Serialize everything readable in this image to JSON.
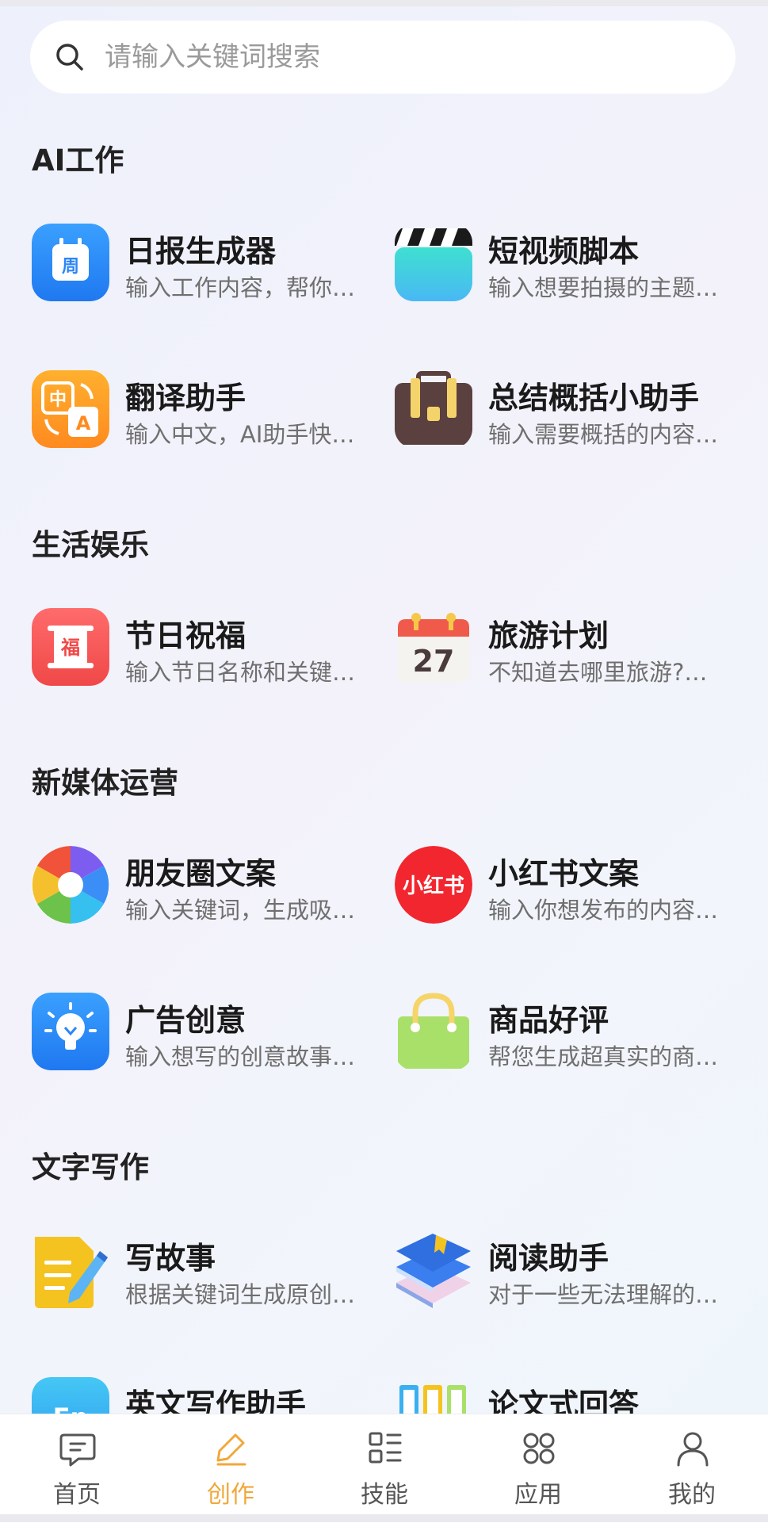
{
  "search": {
    "placeholder": "请输入关键词搜索"
  },
  "sections": [
    {
      "title": "AI工作",
      "tools": [
        {
          "name": "日报生成器",
          "desc": "输入工作内容，帮你…",
          "icon": "calendar-week-icon",
          "iconLabel": "周"
        },
        {
          "name": "短视频脚本",
          "desc": "输入想要拍摄的主题…",
          "icon": "clapperboard-icon"
        },
        {
          "name": "翻译助手",
          "desc": "输入中文，AI助手快…",
          "icon": "translate-icon",
          "iconLabel": "中",
          "iconLabel2": "A"
        },
        {
          "name": "总结概括小助手",
          "desc": "输入需要概括的内容…",
          "icon": "briefcase-icon"
        }
      ]
    },
    {
      "title": "生活娱乐",
      "tools": [
        {
          "name": "节日祝福",
          "desc": "输入节日名称和关键…",
          "icon": "fu-scroll-icon",
          "iconLabel": "福"
        },
        {
          "name": "旅游计划",
          "desc": "不知道去哪里旅游?…",
          "icon": "calendar-day-icon",
          "iconLabel": "27"
        }
      ]
    },
    {
      "title": "新媒体运营",
      "tools": [
        {
          "name": "朋友圈文案",
          "desc": "输入关键词，生成吸…",
          "icon": "aperture-icon"
        },
        {
          "name": "小红书文案",
          "desc": "输入你想发布的内容…",
          "icon": "xiaohongshu-icon",
          "iconLabel": "小红书"
        },
        {
          "name": "广告创意",
          "desc": "输入想写的创意故事…",
          "icon": "lightbulb-icon"
        },
        {
          "name": "商品好评",
          "desc": "帮您生成超真实的商…",
          "icon": "shopping-bag-icon"
        }
      ]
    },
    {
      "title": "文字写作",
      "tools": [
        {
          "name": "写故事",
          "desc": "根据关键词生成原创…",
          "icon": "notepad-pencil-icon"
        },
        {
          "name": "阅读助手",
          "desc": "对于一些无法理解的…",
          "icon": "books-icon"
        },
        {
          "name": "英文写作助手",
          "desc": "",
          "icon": "english-icon",
          "iconLabel": "En"
        },
        {
          "name": "论文式回答",
          "desc": "",
          "icon": "binders-icon"
        }
      ]
    }
  ],
  "tabs": [
    {
      "label": "首页",
      "icon": "chat-bubble-icon",
      "active": false
    },
    {
      "label": "创作",
      "icon": "pencil-icon",
      "active": true
    },
    {
      "label": "技能",
      "icon": "list-grid-icon",
      "active": false
    },
    {
      "label": "应用",
      "icon": "apps-icon",
      "active": false
    },
    {
      "label": "我的",
      "icon": "user-icon",
      "active": false
    }
  ],
  "colors": {
    "accent": "#f1a83a",
    "inactive": "#555555"
  }
}
